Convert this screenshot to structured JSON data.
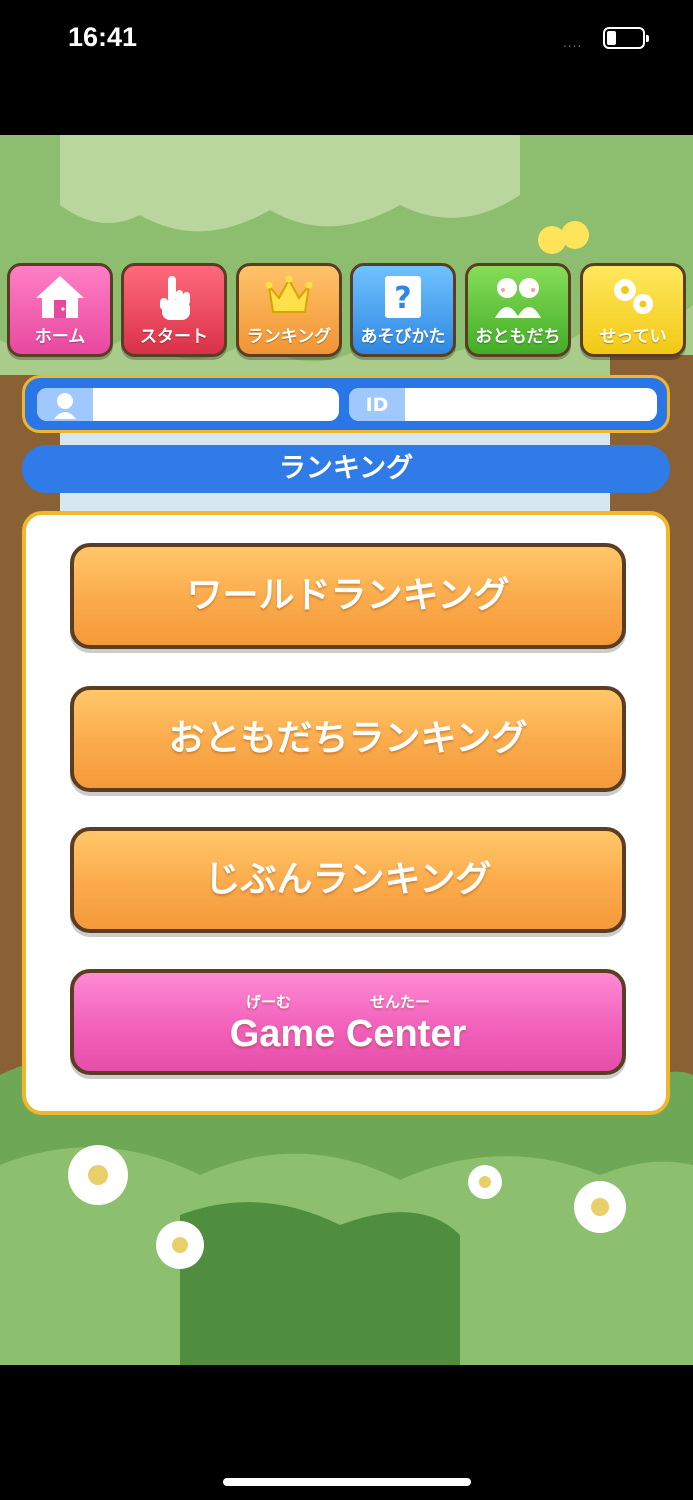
{
  "status_bar": {
    "time": "16:41",
    "signal": "....",
    "battery_level": 0.25
  },
  "menu": {
    "home": "ホーム",
    "start": "スタート",
    "ranking": "ランキング",
    "how_to_play": "あそびかた",
    "friends": "おともだち",
    "settings": "せってい"
  },
  "profile": {
    "name": "",
    "id_tag": "ID",
    "id_value": ""
  },
  "section_title": "ランキング",
  "buttons": {
    "world": "ワールドランキング",
    "friends": "おともだちランキング",
    "self": "じぶんランキング",
    "game_center": "Game Center",
    "ruby_game": "げーむ",
    "ruby_center": "せんたー"
  },
  "colors": {
    "frame_border": "#f0b62c",
    "title_blue": "#2f7be8",
    "orange_button": "#f49a39",
    "pink_button": "#e64ea9"
  }
}
